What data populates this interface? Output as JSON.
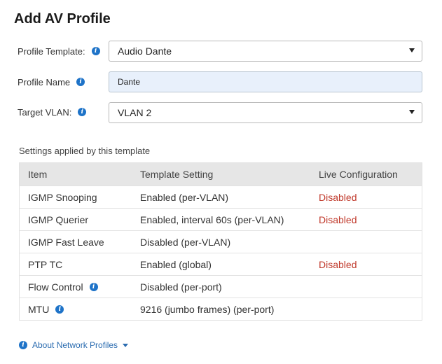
{
  "dialog": {
    "title": "Add AV Profile"
  },
  "form": {
    "profile_template": {
      "label": "Profile Template:",
      "value": "Audio Dante"
    },
    "profile_name": {
      "label": "Profile Name",
      "value": "Dante"
    },
    "target_vlan": {
      "label": "Target VLAN:",
      "value": "VLAN 2"
    }
  },
  "settings": {
    "heading": "Settings applied by this template",
    "columns": [
      "Item",
      "Template Setting",
      "Live Configuration"
    ],
    "rows": [
      {
        "item": "IGMP Snooping",
        "template": "Enabled (per-VLAN)",
        "live": "Disabled",
        "info": false
      },
      {
        "item": "IGMP Querier",
        "template": "Enabled, interval 60s (per-VLAN)",
        "live": "Disabled",
        "info": false
      },
      {
        "item": "IGMP Fast Leave",
        "template": "Disabled (per-VLAN)",
        "live": "",
        "info": false
      },
      {
        "item": "PTP TC",
        "template": "Enabled (global)",
        "live": "Disabled",
        "info": false
      },
      {
        "item": "Flow Control",
        "template": "Disabled (per-port)",
        "live": "",
        "info": true
      },
      {
        "item": "MTU",
        "template": "9216 (jumbo frames) (per-port)",
        "live": "",
        "info": true
      }
    ]
  },
  "footer": {
    "link_label": "About Network Profiles"
  },
  "colors": {
    "accent": "#1e73c8",
    "status_disabled": "#c0392b",
    "input_fill": "#e8f0fb"
  },
  "icons": {
    "info": "info-circle-icon",
    "dropdown": "caret-down-icon"
  }
}
